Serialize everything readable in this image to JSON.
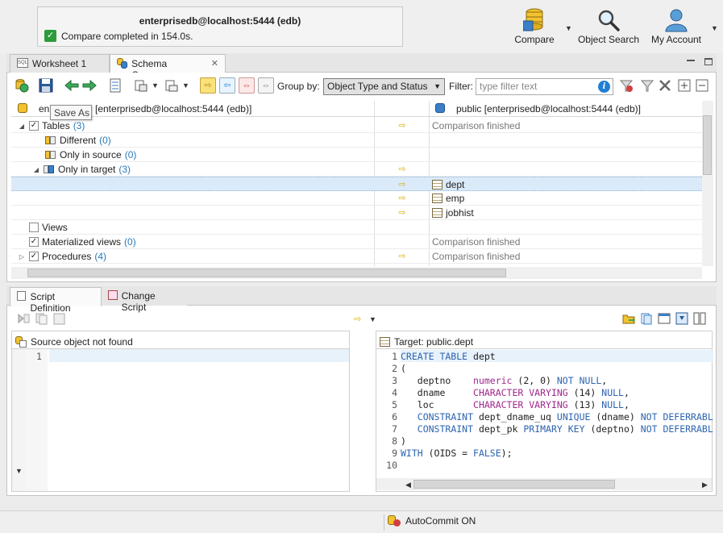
{
  "header": {
    "connection_title": "enterprisedb@localhost:5444 (edb)",
    "status_text": "Compare completed in 154.0s.",
    "buttons": [
      {
        "label": "Compare",
        "icon": "database-compare-icon"
      },
      {
        "label": "Object Search",
        "icon": "magnifier-icon"
      },
      {
        "label": "My Account",
        "icon": "user-icon"
      }
    ]
  },
  "tabs": [
    {
      "label": "Worksheet 1",
      "icon": "sql-sheet-icon"
    },
    {
      "label": "Schema Compare",
      "icon": "schema-compare-icon",
      "close": "✕"
    }
  ],
  "toolbar": {
    "group_by_label": "Group by:",
    "group_by_value": "Object Type and Status",
    "filter_label": "Filter:",
    "filter_placeholder": "type filter text",
    "tooltip": "Save As"
  },
  "grid": {
    "source_header": "enterprisedb@localhost:5444 (edb)",
    "source_header_prefix": "en",
    "source_header_visible": "[enterprisedb@localhost:5444 (edb)]",
    "target_header": "public [enterprisedb@localhost:5444 (edb)]",
    "rows": [
      {
        "label": "Tables",
        "count": "(3)",
        "right": "Comparison finished"
      },
      {
        "label": "Different",
        "count": "(0)",
        "right": ""
      },
      {
        "label": "Only in source",
        "count": "(0)",
        "right": ""
      },
      {
        "label": "Only in target",
        "count": "(3)",
        "right": ""
      },
      {
        "label": "",
        "count": "",
        "right": "dept"
      },
      {
        "label": "",
        "count": "",
        "right": "emp"
      },
      {
        "label": "",
        "count": "",
        "right": "jobhist"
      },
      {
        "label": "Views",
        "count": "",
        "right": ""
      },
      {
        "label": "Materialized views",
        "count": "(0)",
        "right": "Comparison finished"
      },
      {
        "label": "Procedures",
        "count": "(4)",
        "right": "Comparison finished"
      }
    ]
  },
  "bottom_tabs": [
    {
      "label": "Script Definition"
    },
    {
      "label": "Change Script"
    }
  ],
  "source_pane": {
    "title": "Source object not found",
    "lines": [
      "1"
    ]
  },
  "target_pane": {
    "title": "Target: public.dept",
    "line_numbers": [
      "1",
      "2",
      "3",
      "4",
      "5",
      "6",
      "7",
      "8",
      "9",
      "10"
    ]
  },
  "statusbar": {
    "autocommit": "AutoCommit ON"
  },
  "colors": {
    "accent_yellow": "#f8e27a",
    "count_blue": "#2a7bb8",
    "keyword_blue": "#2d64b0",
    "type_purple": "#a0288c"
  }
}
